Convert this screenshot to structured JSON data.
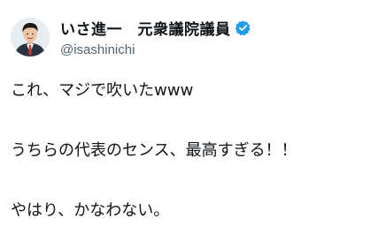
{
  "post": {
    "author": {
      "display_name": "いさ進一　元衆議院議員",
      "handle": "@isashinichi",
      "verified": true,
      "verified_icon": "verified-badge-icon",
      "verified_color": "#1d9bf0"
    },
    "lines": [
      "これ、マジで吹いたwww",
      "うちらの代表のセンス、最高すぎる！！",
      "やはり、かなわない。"
    ]
  }
}
